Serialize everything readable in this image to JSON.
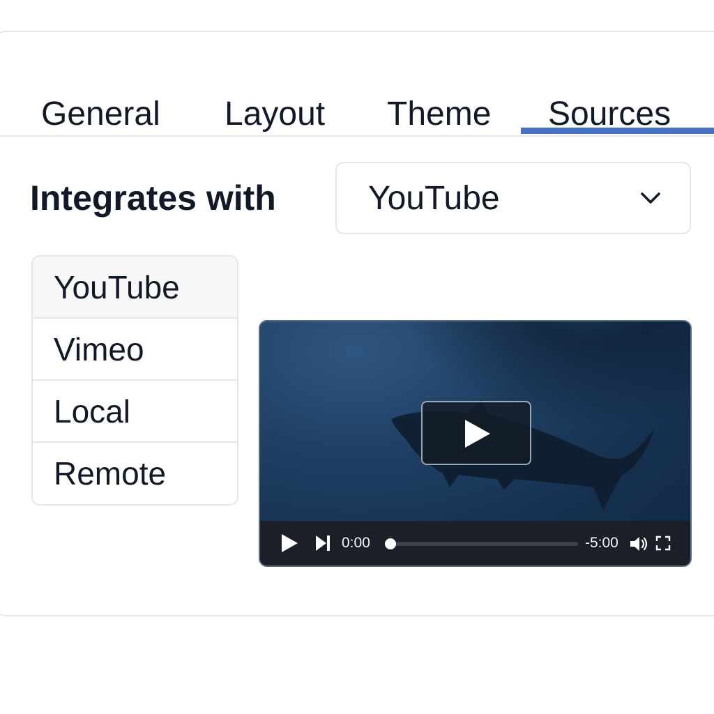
{
  "tabs": [
    {
      "label": "General",
      "active": false
    },
    {
      "label": "Layout",
      "active": false
    },
    {
      "label": "Theme",
      "active": false
    },
    {
      "label": "Sources",
      "active": true
    }
  ],
  "accent_color": "#4a72c3",
  "integration": {
    "label": "Integrates with",
    "selected": "YouTube",
    "options": [
      "YouTube",
      "Vimeo",
      "Local",
      "Remote"
    ]
  },
  "player": {
    "current_time": "0:00",
    "remaining_time": "-5:00",
    "progress": 0,
    "icons": [
      "play-icon",
      "skip-next-icon",
      "volume-icon",
      "fullscreen-icon"
    ]
  }
}
